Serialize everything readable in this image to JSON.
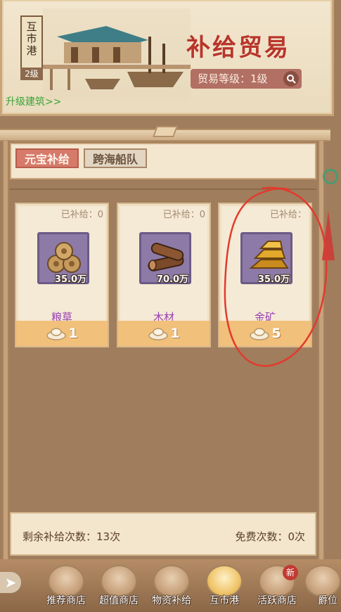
{
  "header": {
    "port_name": "互市港",
    "port_level": "2级",
    "title": "补给贸易",
    "trade_level_text": "贸易等级：1级",
    "upgrade_link": "升级建筑>>"
  },
  "tabs": [
    {
      "label": "元宝补给",
      "active": true
    },
    {
      "label": "跨海船队",
      "active": false
    }
  ],
  "cards": [
    {
      "supplied": "已补给：0",
      "amount": "35.0万",
      "name": "粮草",
      "icon": "grain-bundles-icon",
      "price": "1"
    },
    {
      "supplied": "已补给：0",
      "amount": "70.0万",
      "name": "木材",
      "icon": "wood-logs-icon",
      "price": "1"
    },
    {
      "supplied": "已补给：",
      "amount": "35.0万",
      "name": "金矿",
      "icon": "gold-ingot-icon",
      "price": "5"
    }
  ],
  "info": {
    "remaining": "剩余补给次数：13次",
    "free": "免费次数：0次"
  },
  "nav": {
    "items": [
      {
        "label": "推荐商店"
      },
      {
        "label": "超值商店"
      },
      {
        "label": "物资补给"
      },
      {
        "label": "互市港"
      },
      {
        "label": "活跃商店"
      },
      {
        "label": "爵位"
      }
    ],
    "new_badge": "新"
  },
  "colors": {
    "accent_red": "#b8352b",
    "purple_text": "#9a3fb5",
    "green_link": "#3aa43a",
    "annotation_red": "#e23a2e"
  }
}
